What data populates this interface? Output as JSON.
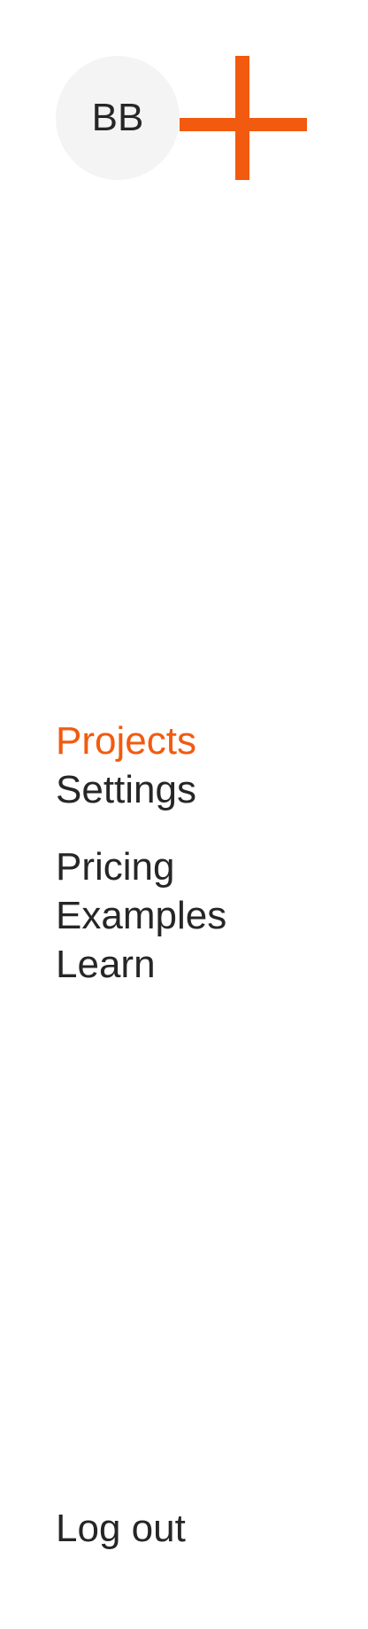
{
  "header": {
    "avatar_initials": "BB",
    "logo_icon": "plus-cross-logo-icon",
    "accent_color": "#f25a0f"
  },
  "nav": {
    "primary": [
      {
        "label": "Projects",
        "active": true
      },
      {
        "label": "Settings",
        "active": false
      }
    ],
    "secondary": [
      {
        "label": "Pricing"
      },
      {
        "label": "Examples"
      },
      {
        "label": "Learn"
      }
    ]
  },
  "footer": {
    "logout_label": "Log out"
  }
}
